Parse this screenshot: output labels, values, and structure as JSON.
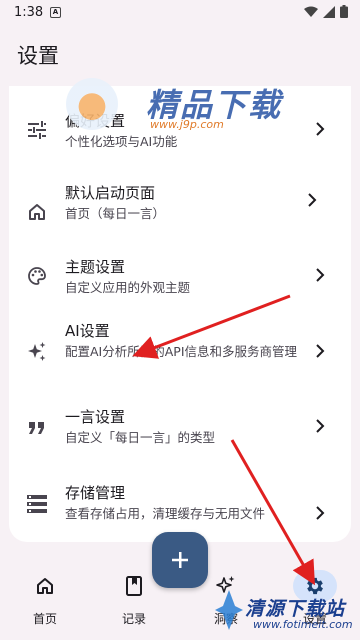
{
  "status_bar": {
    "time": "1:38",
    "notification_badge": "A"
  },
  "header": {
    "title": "设置"
  },
  "settings_items": [
    {
      "title": "偏好设置",
      "subtitle": "个性化选项与AI功能",
      "icon": "tune-icon"
    },
    {
      "title": "默认启动页面",
      "subtitle": "首页（每日一言）",
      "icon": "home-icon"
    },
    {
      "title": "主题设置",
      "subtitle": "自定义应用的外观主题",
      "icon": "palette-icon"
    },
    {
      "title": "AI设置",
      "subtitle": "配置AI分析所需的API信息和多服务商管理",
      "icon": "sparkle-icon"
    },
    {
      "title": "一言设置",
      "subtitle": "自定义「每日一言」的类型",
      "icon": "quote-icon"
    },
    {
      "title": "存储管理",
      "subtitle": "查看存储占用，清理缓存与无用文件",
      "icon": "storage-icon"
    }
  ],
  "fab": {
    "label": "+"
  },
  "bottom_nav": [
    {
      "label": "首页",
      "icon": "home-icon"
    },
    {
      "label": "记录",
      "icon": "book-icon"
    },
    {
      "label": "洞察",
      "icon": "sparkle-icon"
    },
    {
      "label": "设置",
      "icon": "gear-icon",
      "active": true
    }
  ],
  "watermarks": {
    "top_brand": "精品下载",
    "top_url": "www.j9p.com",
    "bottom_brand": "清源下载站",
    "bottom_url": "www.fotimeit.com"
  },
  "colors": {
    "background": "#f7f1f5",
    "card": "#ffffff",
    "fab": "#3a5a84",
    "active_nav_indicator": "#d5e3fb",
    "annotation_arrow": "#e02020"
  }
}
